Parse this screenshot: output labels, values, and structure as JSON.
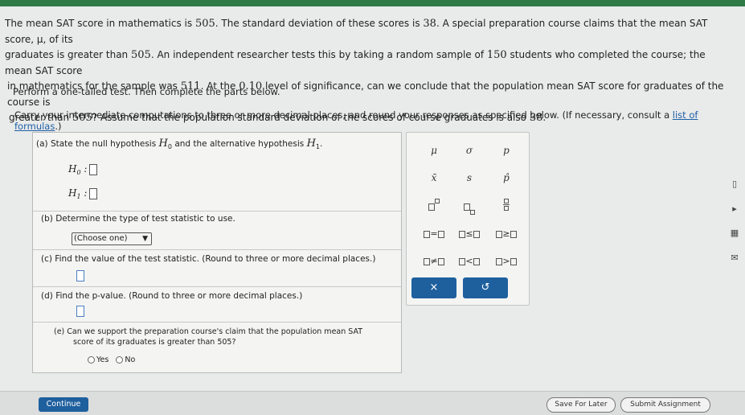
{
  "problem": {
    "l1a": "The mean SAT score in mathematics is ",
    "l1n1": "505",
    "l1b": ". The standard deviation of these scores is ",
    "l1n2": "38",
    "l1c": ". A special preparation course claims that the mean SAT score, μ, of its",
    "l2a": "graduates is greater than ",
    "l2n1": "505",
    "l2b": ". An independent researcher tests this by taking a random sample of ",
    "l2n2": "150",
    "l2c": " students who completed the course; the mean SAT score",
    "l3a": "in mathematics for the sample was ",
    "l3n1": "511",
    "l3b": ". At the ",
    "l3n2": "0.10",
    "l3c": " level of significance, can we conclude that the population mean SAT score for graduates of the course is",
    "l4a": "greater than ",
    "l4n1": "505",
    "l4b": "? Assume that the population standard deviation of the scores of course graduates is also ",
    "l4n2": "38",
    "l4c": "."
  },
  "instructions": {
    "perform": "Perform a one-tailed test. Then complete the parts below.",
    "carry_pre": "Carry your intermediate computations to three or more decimal places, and round your responses as specified below. (If necessary, consult a ",
    "link": "list of formulas",
    "carry_post": ".)"
  },
  "parts": {
    "a_pre": "(a)  State the null hypothesis ",
    "a_h0": "H",
    "a_h0_sub": "0",
    "a_mid": " and the alternative hypothesis ",
    "a_h1": "H",
    "a_h1_sub": "1",
    "a_post": ".",
    "h0_label": "H",
    "h0_sub": "0",
    "h1_label": "H",
    "h1_sub": "1",
    "colon": ":",
    "b": "(b)  Determine the type of test statistic to use.",
    "b_select": "(Choose one)",
    "b_arrow": "▼",
    "c": "(c)  Find the value of the test statistic. (Round to three or more decimal places.)",
    "d": "(d)  Find the p-value. (Round to three or more decimal places.)",
    "e1": "(e)  Can we support the preparation course's claim that the population mean SAT",
    "e2": "score of its graduates is greater than 505?",
    "yes": "Yes",
    "no": "No"
  },
  "palette": {
    "mu": "μ",
    "sigma": "σ",
    "p": "p",
    "xbar": "x̄",
    "s": "s",
    "phat": "p̂",
    "eq": "=",
    "le": "≤",
    "ge": "≥",
    "ne": "≠",
    "lt": "<",
    "gt": ">",
    "clear": "×",
    "undo": "↺"
  },
  "footer": {
    "continue": "Continue",
    "save": "Save For Later",
    "submit": "Submit Assignment"
  },
  "colors": {
    "primary": "#1e5f9e",
    "topbar": "#2f7a47"
  }
}
